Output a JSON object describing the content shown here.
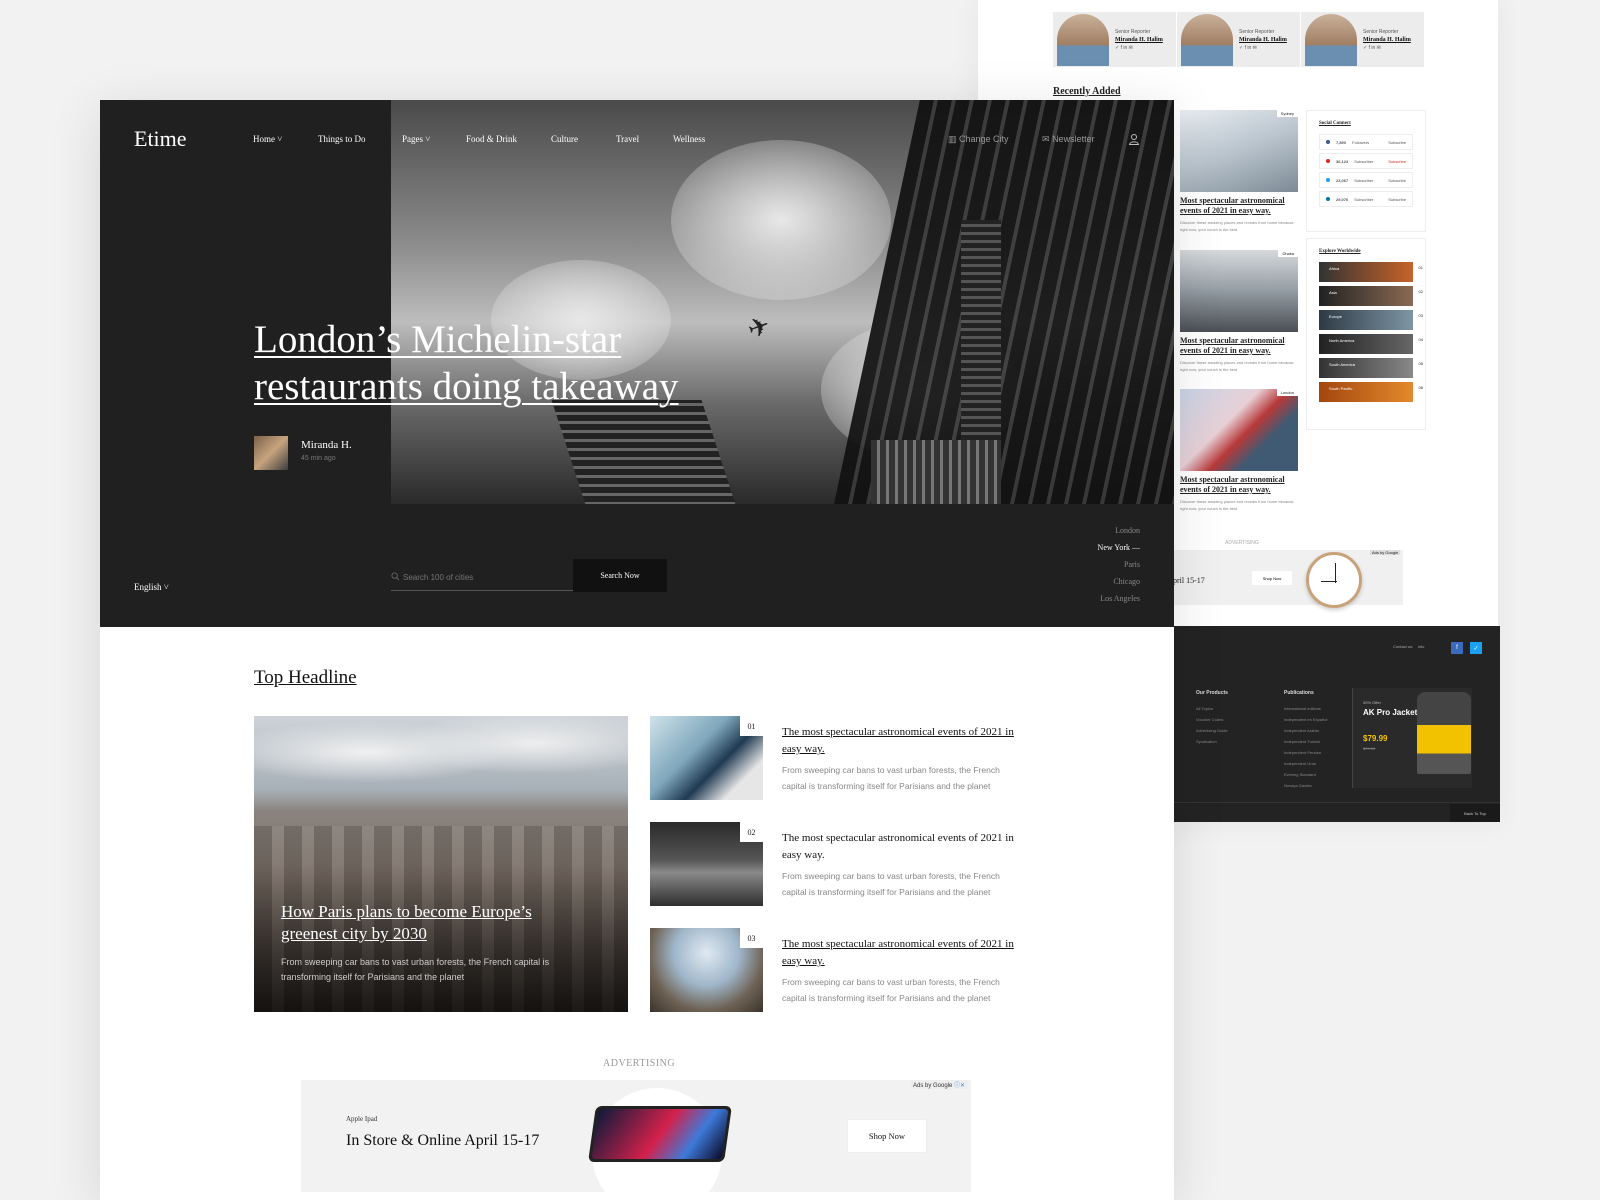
{
  "background_page": {
    "authors": [
      {
        "role": "Senior Reporter",
        "name": "Miranda H. Halim"
      },
      {
        "role": "Senior Reporter",
        "name": "Miranda H. Halim"
      },
      {
        "role": "Senior Reporter",
        "name": "Miranda H. Halim"
      }
    ],
    "recently_added_title": "Recently Added",
    "recent": [
      {
        "tag": "Sydney",
        "title": "Most spectacular astronomical events of 2021 in easy way.",
        "text": "Discover these amazing places and reveals from home because right now, your couch is the best."
      },
      {
        "tag": "Dhaka",
        "title": "Most spectacular astronomical events of 2021 in easy way.",
        "text": "Discover these amazing places and reveals from home because right now, your couch is the best."
      },
      {
        "tag": "London",
        "title": "Most spectacular astronomical events of 2021 in easy way.",
        "text": "Discover these amazing places and reveals from home because right now, your couch is the best."
      }
    ],
    "social_title": "Social Connect",
    "social": [
      {
        "count": "7,890",
        "label": "Followers",
        "action": "Subscribe"
      },
      {
        "count": "36,123",
        "label": "Subscriber",
        "action": "Subscribe"
      },
      {
        "count": "23,067",
        "label": "Subscriber",
        "action": "Subscribe"
      },
      {
        "count": "29,076",
        "label": "Subscriber",
        "action": "Subscribe"
      }
    ],
    "explore_title": "Explore Worldwide",
    "explore": [
      {
        "name": "Africa",
        "num": "01"
      },
      {
        "name": "Asia",
        "num": "02"
      },
      {
        "name": "Europe",
        "num": "03"
      },
      {
        "name": "North America",
        "num": "04"
      },
      {
        "name": "South America",
        "num": "05"
      },
      {
        "name": "South Pacific",
        "num": "06"
      }
    ],
    "ad_label": "ADVERTISING",
    "ad_text": "pril 15-17",
    "ad_button": "Shop Now",
    "ads_by": "Ads by Google",
    "footer": {
      "contact": "Contact us:",
      "contact_value": "Info",
      "products_title": "Our Products",
      "products": [
        "All Topics",
        "Voucher Codes",
        "Advertising Guide",
        "Syndication"
      ],
      "publications_title": "Publications",
      "publications": [
        "International editions",
        "Independent en Español",
        "Independent Arabia",
        "Independent Turkish",
        "Independent Persian",
        "Independent Urdu",
        "Evening Standard",
        "Novaya Gazeta"
      ],
      "promo_discount": "30% Offer",
      "promo_name": "AK Pro Jacket",
      "promo_price": "$79.99",
      "promo_old_price": "$99.00",
      "back_to_top": "Back To Top"
    }
  },
  "header": {
    "logo": "Etime",
    "nav": [
      {
        "label": "Home ˅"
      },
      {
        "label": "Things to Do"
      },
      {
        "label": "Pages ˅"
      },
      {
        "label": "Food & Drink"
      },
      {
        "label": "Culture"
      },
      {
        "label": "Travel"
      },
      {
        "label": "Wellness"
      }
    ],
    "change_city": "Change City",
    "newsletter": "Newsletter"
  },
  "hero": {
    "title": "London’s Michelin-star restaurants doing takeaway",
    "author": "Miranda H.",
    "time": "45 min ago",
    "language": "English ˅",
    "search_placeholder": "Search 100 of cities",
    "search_button": "Search Now",
    "cities": [
      {
        "name": "London",
        "active": false
      },
      {
        "name": "New York —",
        "active": true
      },
      {
        "name": "Paris",
        "active": false
      },
      {
        "name": "Chicago",
        "active": false
      },
      {
        "name": "Los Angeles",
        "active": false
      }
    ]
  },
  "top_headline": {
    "title": "Top Headline",
    "feature_title": "How Paris plans to become Europe’s greenest city by 2030",
    "feature_text": "From sweeping car bans to vast urban forests, the French capital is transforming itself for Parisians and the planet",
    "items": [
      {
        "num": "01",
        "title": "The most spectacular astronomical events of 2021 in easy way.",
        "text": "From sweeping car bans to vast urban forests, the French capital is transforming itself for Parisians and the planet"
      },
      {
        "num": "02",
        "title": "The most spectacular astronomical events of 2021 in easy way.",
        "text": "From sweeping car bans to vast urban forests, the French capital is transforming itself for Parisians and the planet"
      },
      {
        "num": "03",
        "title": "The most spectacular astronomical events of 2021 in easy way.",
        "text": "From sweeping car bans to vast urban forests, the French capital is transforming itself for Parisians and the planet"
      }
    ]
  },
  "advert": {
    "label": "ADVERTISING",
    "brand": "Apple Ipad",
    "headline": "In Store & Online April 15-17",
    "button": "Shop Now",
    "ads_by": "Ads by Google"
  }
}
